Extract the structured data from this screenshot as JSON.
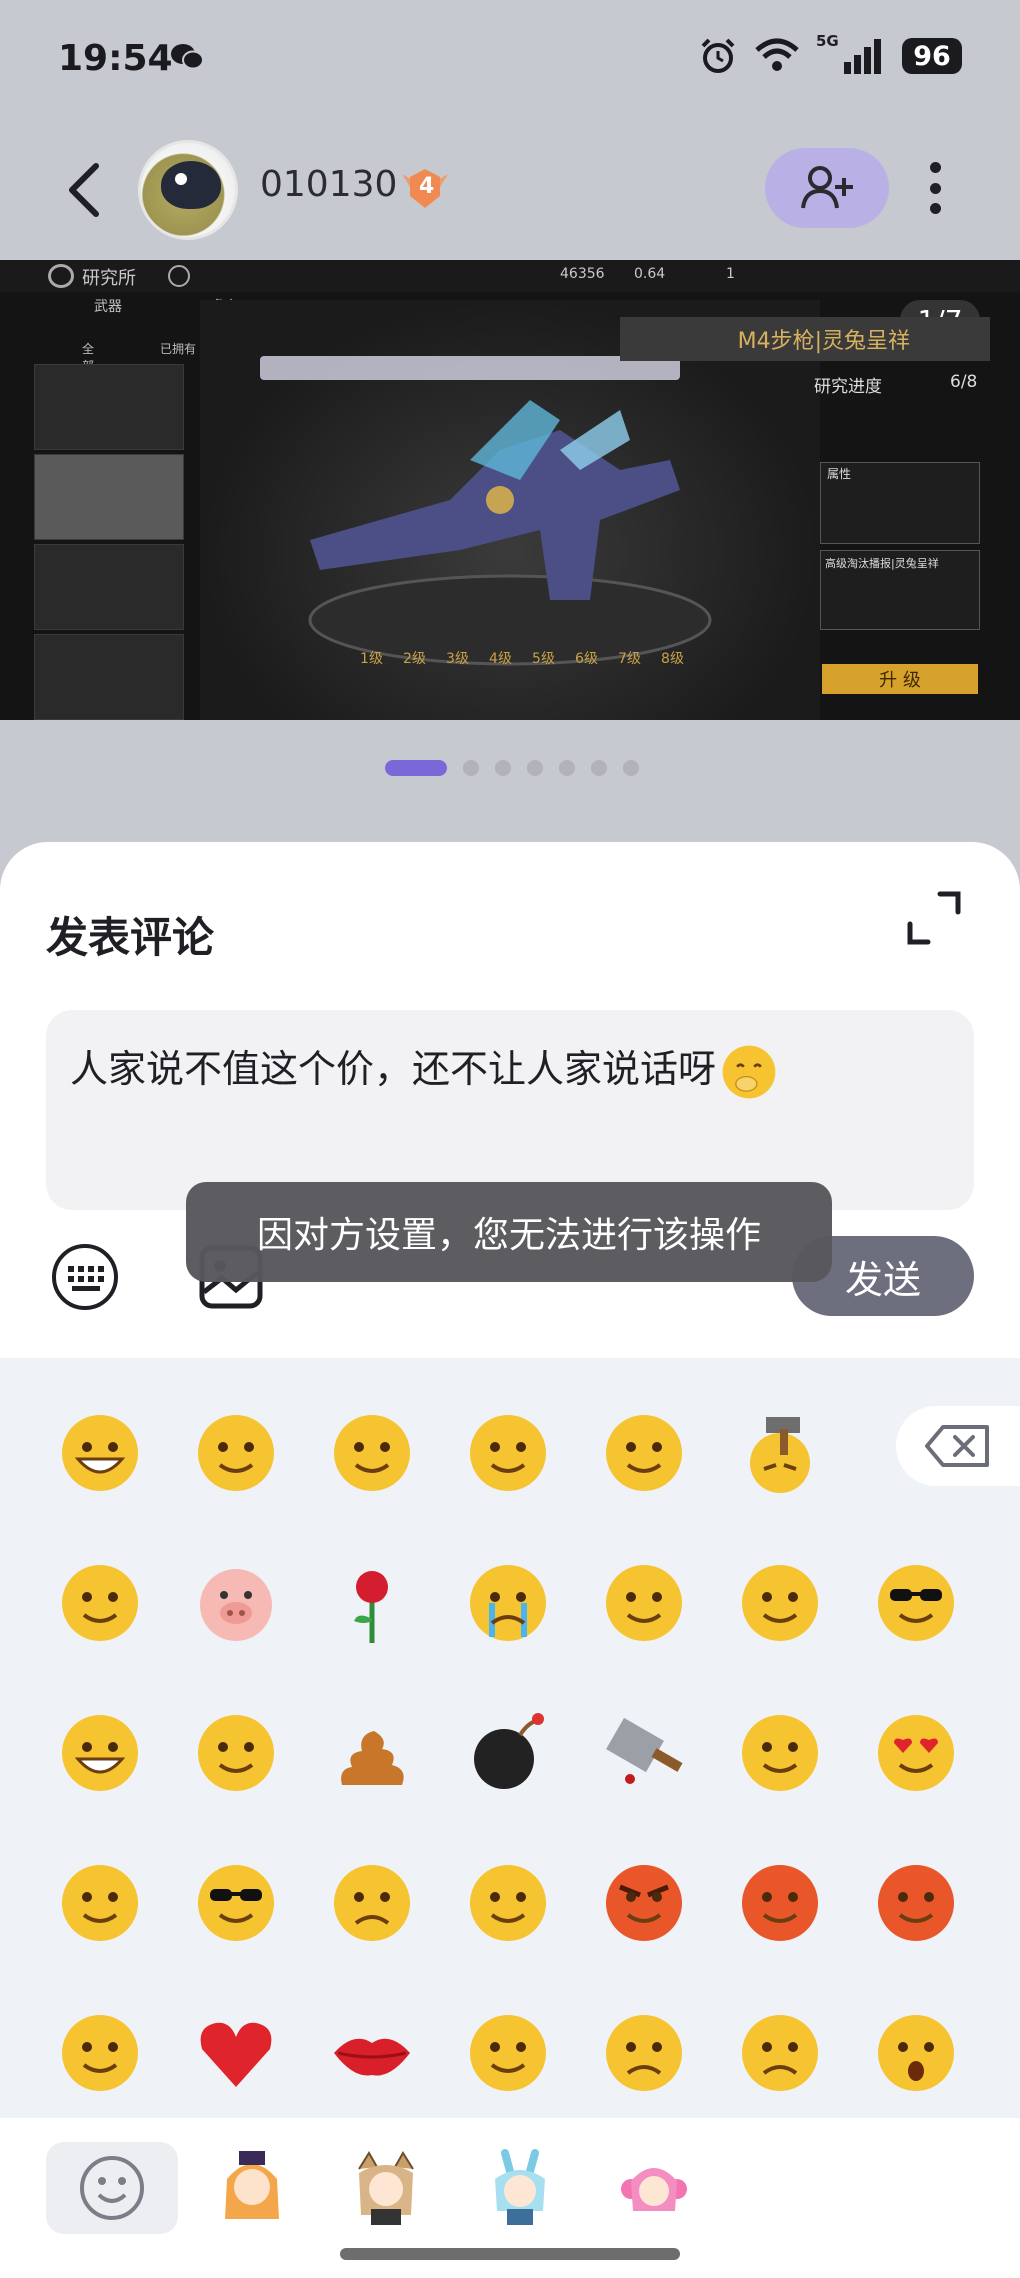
{
  "status_bar": {
    "time": "19:54",
    "network": "5G",
    "battery": "96"
  },
  "header": {
    "username": "010130",
    "level": "4"
  },
  "image": {
    "counter": "1/7",
    "topbar_title": "研究所",
    "currency": [
      "46356",
      "0.64",
      "1"
    ],
    "subtabs": [
      "武器",
      "角色"
    ],
    "filter_all": "全部",
    "filter_owned": "已拥有",
    "weapon_title": "M4步枪|灵兔呈祥",
    "progress_label": "研究进度",
    "progress_value": "6/8",
    "attr_title": "属性",
    "desc_title": "高级淘汰播报|灵兔呈祥",
    "upgrade_label": "升 级",
    "levels": [
      "1级",
      "2级",
      "3级",
      "4级",
      "5级",
      "6级",
      "7级",
      "8级"
    ]
  },
  "pager": {
    "total": 7,
    "active": 0
  },
  "comment": {
    "title": "发表评论",
    "text": "人家说不值这个价，还不让人家说话呀",
    "toast": "因对方设置，您无法进行该操作",
    "send_label": "发送"
  },
  "emoji_rows": [
    [
      "grin-emoji",
      "tongue-wink-emoji",
      "sweat-squint-emoji",
      "cover-mouth-emoji",
      "thinking-emoji",
      "hammer-emoji"
    ],
    [
      "smug-emoji",
      "pig-emoji",
      "rose-emoji",
      "crying-emoji",
      "teary-grimace-emoji",
      "shush-emoji",
      "sunglasses-cool-emoji"
    ],
    [
      "laugh-cry-emoji",
      "shy-emoji",
      "poop-emoji",
      "bomb-emoji",
      "cleaver-emoji",
      "smile-emoji",
      "heart-eyes-emoji"
    ],
    [
      "relieved-emoji",
      "sunglasses-emoji",
      "worried-emoji",
      "slight-smile-emoji",
      "angry-emoji",
      "sigh-emoji",
      "sweat-emoji"
    ],
    [
      "nervous-emoji",
      "heart-emoji",
      "lips-emoji",
      "eyeroll-emoji",
      "confused-emoji",
      "sad-emoji",
      "surprised-emoji"
    ]
  ],
  "colors": {
    "accent": "#7a67d8",
    "add_friend_bg": "#b9b1e6",
    "send_bg": "#6e6f7e",
    "emoji_panel_bg": "#eff2f6"
  }
}
